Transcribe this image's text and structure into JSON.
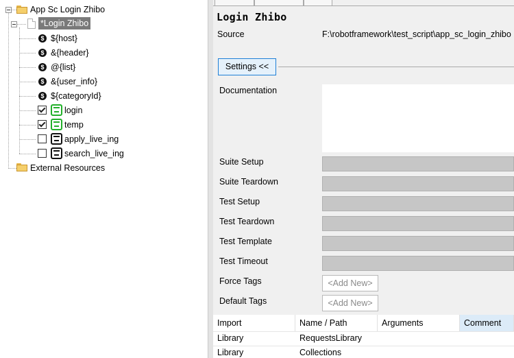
{
  "tree": {
    "root": {
      "label": "App Sc Login Zhibo",
      "icon": "folder-icon"
    },
    "suite": {
      "label": "*Login Zhibo",
      "icon": "file-icon",
      "selected": true
    },
    "variables": [
      {
        "label": "${host}",
        "icon": "variable-icon"
      },
      {
        "label": "&{header}",
        "icon": "variable-icon"
      },
      {
        "label": "@{list}",
        "icon": "variable-icon"
      },
      {
        "label": "&{user_info}",
        "icon": "variable-icon"
      },
      {
        "label": "${categoryId}",
        "icon": "variable-icon"
      }
    ],
    "tests": [
      {
        "label": "login",
        "checked": true,
        "icon": "keyword-icon",
        "color": "#22b02a"
      },
      {
        "label": "temp",
        "checked": true,
        "icon": "keyword-icon",
        "color": "#22b02a"
      },
      {
        "label": "apply_live_ing",
        "checked": false,
        "icon": "keyword-icon",
        "color": "#111111"
      },
      {
        "label": "search_live_ing",
        "checked": false,
        "icon": "keyword-icon",
        "color": "#111111"
      }
    ],
    "external": {
      "label": "External Resources",
      "icon": "folder-resource-icon"
    }
  },
  "editor": {
    "title": "Login Zhibo",
    "source_label": "Source",
    "source_value": "F:\\robotframework\\test_script\\app_sc_login_zhibo",
    "settings_button": "Settings <<",
    "documentation_label": "Documentation",
    "documentation_value": "",
    "fields": [
      {
        "label": "Suite Setup",
        "value": ""
      },
      {
        "label": "Suite Teardown",
        "value": ""
      },
      {
        "label": "Test Setup",
        "value": ""
      },
      {
        "label": "Test Teardown",
        "value": ""
      },
      {
        "label": "Test Template",
        "value": ""
      },
      {
        "label": "Test Timeout",
        "value": ""
      }
    ],
    "tag_fields": [
      {
        "label": "Force Tags",
        "button": "<Add New>"
      },
      {
        "label": "Default Tags",
        "button": "<Add New>"
      }
    ],
    "imports_table": {
      "columns": [
        "Import",
        "Name / Path",
        "Arguments",
        "Comment"
      ],
      "active_column": "Comment",
      "rows": [
        [
          "Library",
          "RequestsLibrary",
          "",
          ""
        ],
        [
          "Library",
          "Collections",
          "",
          ""
        ]
      ]
    }
  }
}
